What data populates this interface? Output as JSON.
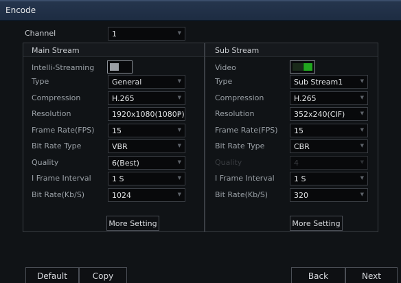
{
  "window": {
    "title": "Encode"
  },
  "channel": {
    "label": "Channel",
    "value": "1"
  },
  "main": {
    "header": "Main Stream",
    "intelli_label": "Intelli-Streaming",
    "intelli_state": "off",
    "rows": [
      {
        "label": "Type",
        "value": "General"
      },
      {
        "label": "Compression",
        "value": "H.265"
      },
      {
        "label": "Resolution",
        "value": "1920x1080(1080P)"
      },
      {
        "label": "Frame Rate(FPS)",
        "value": "15"
      },
      {
        "label": "Bit Rate Type",
        "value": "VBR"
      },
      {
        "label": "Quality",
        "value": "6(Best)"
      },
      {
        "label": "I Frame Interval",
        "value": "1 S"
      },
      {
        "label": "Bit Rate(Kb/S)",
        "value": "1024"
      }
    ],
    "more_setting": "More Setting"
  },
  "sub": {
    "header": "Sub Stream",
    "video_label": "Video",
    "video_state": "on",
    "rows": [
      {
        "label": "Type",
        "value": "Sub Stream1"
      },
      {
        "label": "Compression",
        "value": "H.265"
      },
      {
        "label": "Resolution",
        "value": "352x240(CIF)"
      },
      {
        "label": "Frame Rate(FPS)",
        "value": "15"
      },
      {
        "label": "Bit Rate Type",
        "value": "CBR"
      },
      {
        "label": "Quality",
        "value": "4",
        "disabled": true
      },
      {
        "label": "I Frame Interval",
        "value": "1 S"
      },
      {
        "label": "Bit Rate(Kb/S)",
        "value": "320"
      }
    ],
    "more_setting": "More Setting"
  },
  "footer": {
    "default": "Default",
    "copy": "Copy",
    "back": "Back",
    "next": "Next"
  },
  "icons": {
    "dropdown": "dropdown-arrow-icon"
  },
  "colors": {
    "titlebar": "#1d2c42",
    "toggle_on": "#21a61f",
    "background": "#101316"
  }
}
